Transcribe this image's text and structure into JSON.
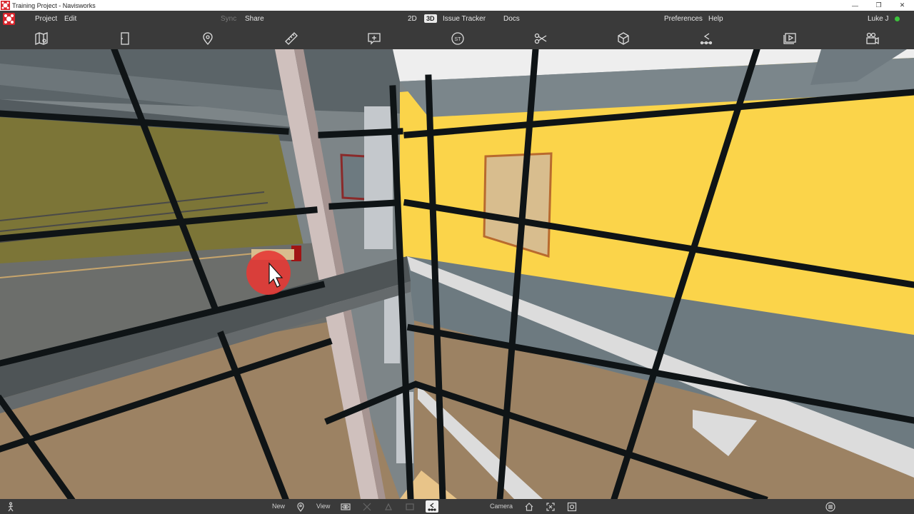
{
  "window": {
    "title": "Training Project - Navisworks"
  },
  "menu": {
    "project": "Project",
    "edit": "Edit",
    "sync": "Sync",
    "share": "Share",
    "view_2d": "2D",
    "view_3d": "3D",
    "issue_tracker": "Issue Tracker",
    "docs": "Docs",
    "preferences": "Preferences",
    "help": "Help",
    "user": "Luke J"
  },
  "toolbar": {
    "icons": [
      "map-icon",
      "sheet-icon",
      "location-pin-icon",
      "measure-ruler-icon",
      "add-markup-icon",
      "st-icon",
      "section-cut-icon",
      "box-icon",
      "walk-path-icon",
      "slideshow-icon",
      "camera-record-icon"
    ],
    "st_label": "ST"
  },
  "bottom": {
    "new_label": "New",
    "view_label": "View",
    "camera_label": "Camera"
  },
  "colors": {
    "chrome": "#3a3a3a",
    "yellow_wall": "#fbd44a",
    "glass": "#6d7a80",
    "floor": "#9c8263",
    "accent_red": "#e53935",
    "status_green": "#3cc23c"
  }
}
